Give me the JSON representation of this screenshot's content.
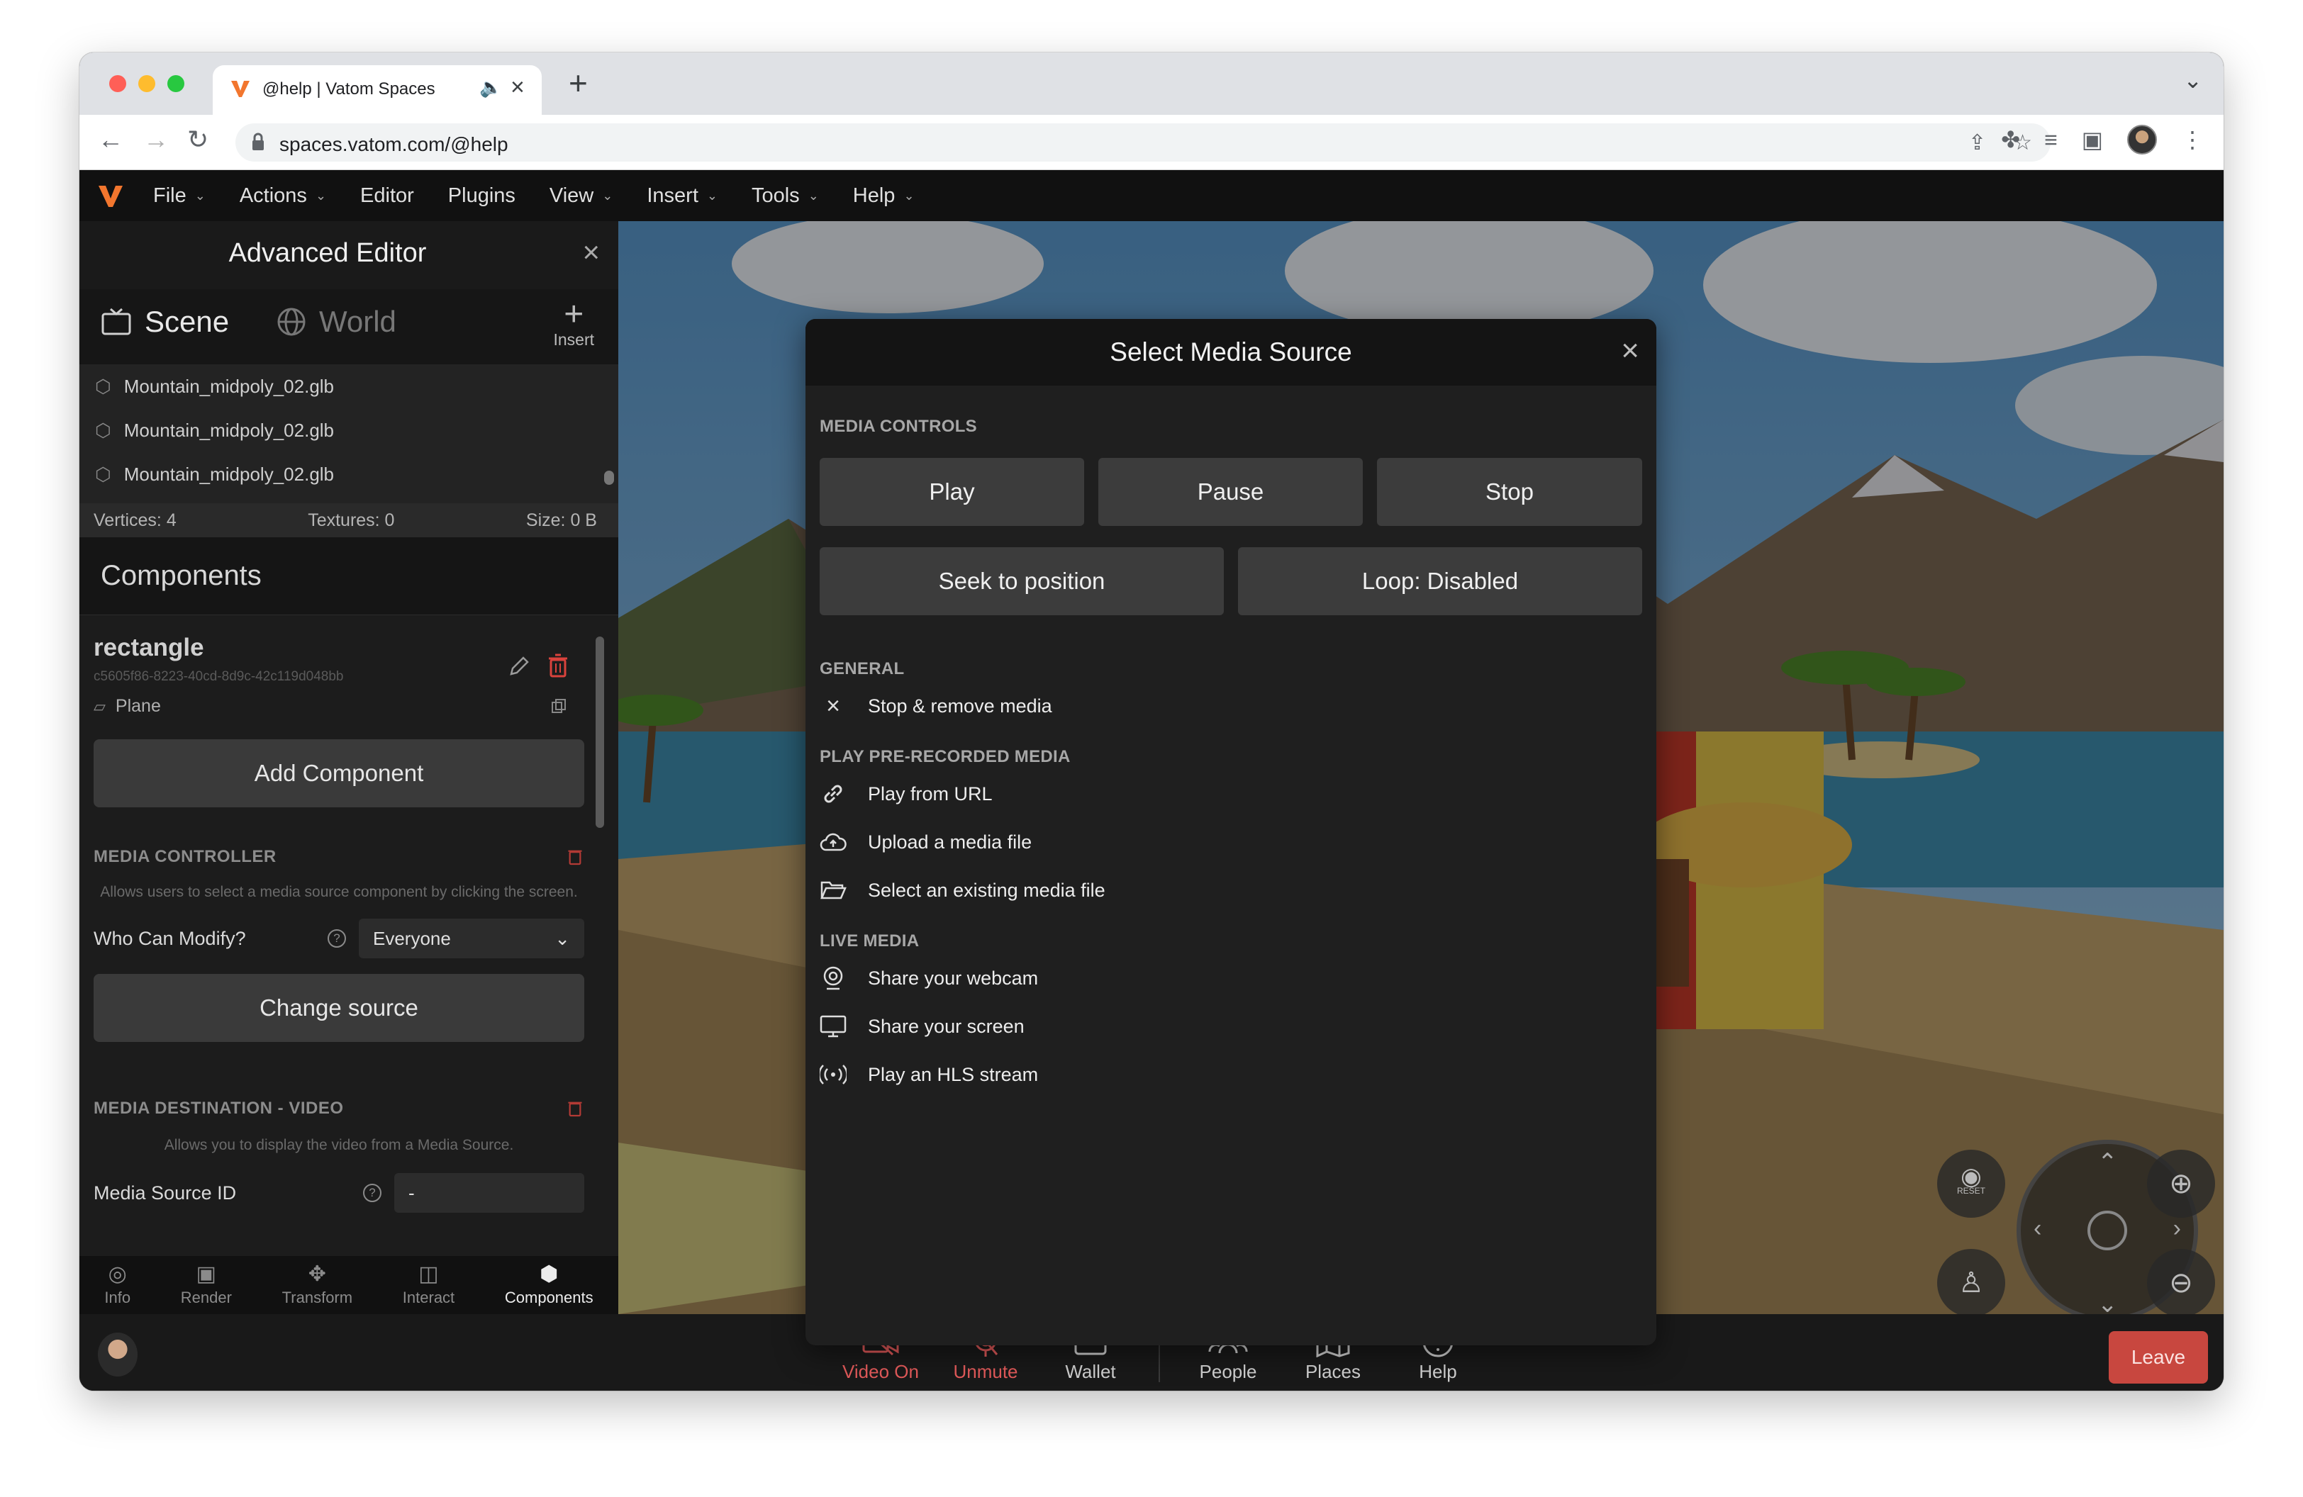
{
  "browser": {
    "tab_title": "@help | Vatom Spaces",
    "url": "spaces.vatom.com/@help"
  },
  "app_menu": [
    "File",
    "Actions",
    "Editor",
    "Plugins",
    "View",
    "Insert",
    "Tools",
    "Help"
  ],
  "panel": {
    "title": "Advanced Editor",
    "tabs": {
      "scene": "Scene",
      "world": "World",
      "insert": "Insert"
    },
    "objects": [
      "Mountain_midpoly_02.glb",
      "Mountain_midpoly_02.glb",
      "Mountain_midpoly_02.glb"
    ],
    "stats": {
      "vertices": "Vertices: 4",
      "textures": "Textures: 0",
      "size": "Size: 0 B"
    },
    "components_title": "Components",
    "entity": {
      "name": "rectangle",
      "id": "c5605f86-8223-40cd-8d9c-42c119d048bb",
      "type": "Plane"
    },
    "add_component": "Add Component",
    "media_controller": {
      "title": "MEDIA CONTROLLER",
      "description": "Allows users to select a media source component by clicking the screen.",
      "who_can_modify_label": "Who Can Modify?",
      "who_can_modify_value": "Everyone",
      "change_source": "Change source"
    },
    "media_destination": {
      "title": "MEDIA DESTINATION - VIDEO",
      "description": "Allows you to display the video from a Media Source.",
      "source_id_label": "Media Source ID",
      "source_id_value": "-"
    },
    "bottom_nav": [
      {
        "label": "Info",
        "icon": "info-icon"
      },
      {
        "label": "Render",
        "icon": "render-icon"
      },
      {
        "label": "Transform",
        "icon": "transform-icon"
      },
      {
        "label": "Interact",
        "icon": "interact-icon"
      },
      {
        "label": "Components",
        "icon": "components-icon"
      }
    ]
  },
  "dialog": {
    "title": "Select Media Source",
    "media_controls_title": "MEDIA CONTROLS",
    "play": "Play",
    "pause": "Pause",
    "stop": "Stop",
    "seek": "Seek to position",
    "loop": "Loop: Disabled",
    "general_title": "GENERAL",
    "stop_remove": "Stop & remove media",
    "prerecorded_title": "PLAY PRE-RECORDED MEDIA",
    "play_url": "Play from URL",
    "upload": "Upload a media file",
    "select_existing": "Select an existing media file",
    "live_title": "LIVE MEDIA",
    "webcam": "Share your webcam",
    "screen": "Share your screen",
    "hls": "Play an HLS stream"
  },
  "appbar": {
    "video": "Video On",
    "unmute": "Unmute",
    "wallet": "Wallet",
    "people": "People",
    "places": "Places",
    "help": "Help",
    "leave": "Leave"
  },
  "scene_controls": {
    "reset": "RESET"
  },
  "colors": {
    "accent_red": "#e35a5a",
    "leave_button": "#c8473f",
    "panel_bg": "#1c1c1c",
    "dialog_bg": "#1f1f1f"
  }
}
